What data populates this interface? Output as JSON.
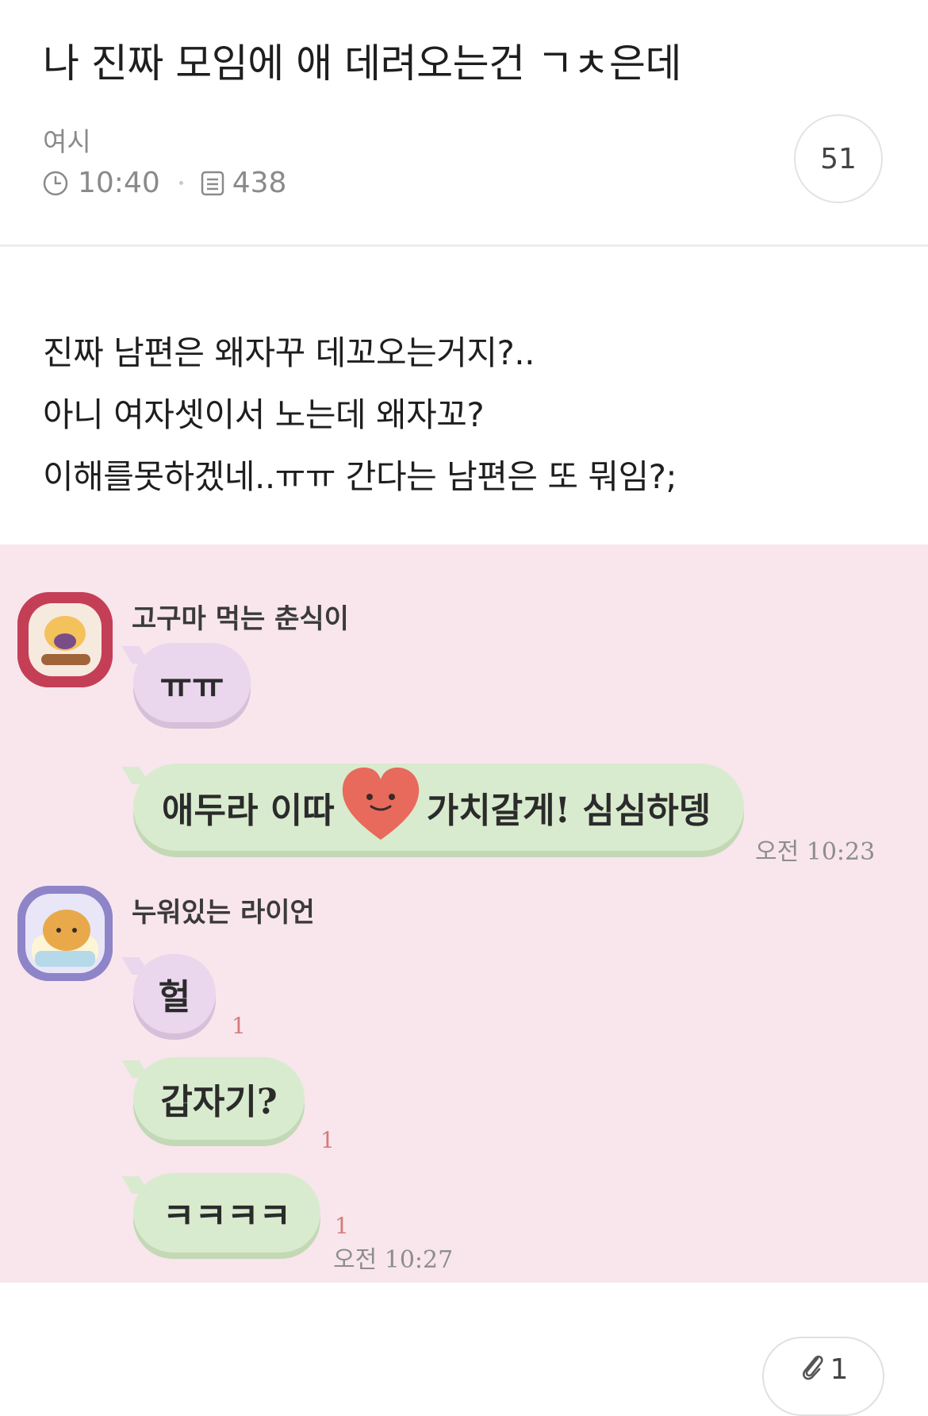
{
  "post": {
    "title": "나 진짜 모임에 애 데려오는건 ㄱㅊ은데",
    "author": "여시",
    "time": "10:40",
    "views": "438",
    "comments": "51"
  },
  "content": {
    "lines": [
      "진짜 남편은 왜자꾸 데꼬오는거지?..",
      "아니 여자셋이서 노는데 왜자꼬?",
      "이해를못하겠네..ㅠㅠ 간다는 남편은 또 뭐임?;"
    ]
  },
  "chat": {
    "messages": [
      {
        "sender": "고구마 먹는 춘식이",
        "bubbles": [
          "ㅠㅠ",
          {
            "before": "애두라 이따",
            "after": "가치갈게! 심심하뎅"
          }
        ],
        "time": "오전 10:23"
      },
      {
        "sender": "누워있는 라이언",
        "bubbles": [
          "헐",
          "갑자기?",
          "ㅋㅋㅋㅋ"
        ],
        "unread": [
          "1",
          "1",
          "1"
        ],
        "time": "오전 10:27"
      }
    ]
  },
  "attachment": {
    "count": "1"
  },
  "colors": {
    "chat_bg": "#f8e6ec",
    "bubble_purple": "#ead6ed",
    "bubble_green": "#d9ebce",
    "heart": "#e86a5c"
  },
  "icons": [
    "clock-icon",
    "document-icon",
    "paperclip-icon",
    "heart-emoticon"
  ]
}
